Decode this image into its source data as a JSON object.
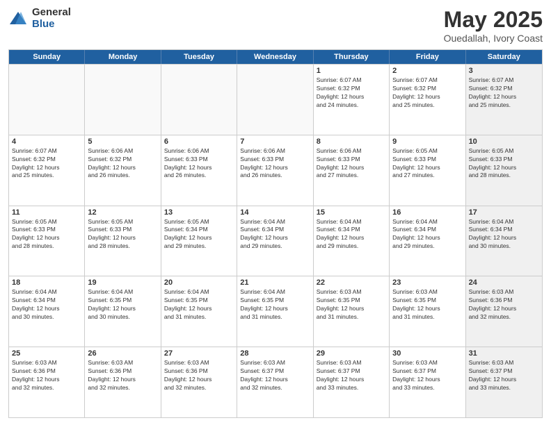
{
  "logo": {
    "general": "General",
    "blue": "Blue"
  },
  "title": {
    "month": "May 2025",
    "location": "Ouedallah, Ivory Coast"
  },
  "header_days": [
    "Sunday",
    "Monday",
    "Tuesday",
    "Wednesday",
    "Thursday",
    "Friday",
    "Saturday"
  ],
  "rows": [
    [
      {
        "day": "",
        "text": "",
        "empty": true
      },
      {
        "day": "",
        "text": "",
        "empty": true
      },
      {
        "day": "",
        "text": "",
        "empty": true
      },
      {
        "day": "",
        "text": "",
        "empty": true
      },
      {
        "day": "1",
        "text": "Sunrise: 6:07 AM\nSunset: 6:32 PM\nDaylight: 12 hours\nand 24 minutes.",
        "empty": false
      },
      {
        "day": "2",
        "text": "Sunrise: 6:07 AM\nSunset: 6:32 PM\nDaylight: 12 hours\nand 25 minutes.",
        "empty": false
      },
      {
        "day": "3",
        "text": "Sunrise: 6:07 AM\nSunset: 6:32 PM\nDaylight: 12 hours\nand 25 minutes.",
        "empty": false,
        "shaded": true
      }
    ],
    [
      {
        "day": "4",
        "text": "Sunrise: 6:07 AM\nSunset: 6:32 PM\nDaylight: 12 hours\nand 25 minutes.",
        "empty": false
      },
      {
        "day": "5",
        "text": "Sunrise: 6:06 AM\nSunset: 6:32 PM\nDaylight: 12 hours\nand 26 minutes.",
        "empty": false
      },
      {
        "day": "6",
        "text": "Sunrise: 6:06 AM\nSunset: 6:33 PM\nDaylight: 12 hours\nand 26 minutes.",
        "empty": false
      },
      {
        "day": "7",
        "text": "Sunrise: 6:06 AM\nSunset: 6:33 PM\nDaylight: 12 hours\nand 26 minutes.",
        "empty": false
      },
      {
        "day": "8",
        "text": "Sunrise: 6:06 AM\nSunset: 6:33 PM\nDaylight: 12 hours\nand 27 minutes.",
        "empty": false
      },
      {
        "day": "9",
        "text": "Sunrise: 6:05 AM\nSunset: 6:33 PM\nDaylight: 12 hours\nand 27 minutes.",
        "empty": false
      },
      {
        "day": "10",
        "text": "Sunrise: 6:05 AM\nSunset: 6:33 PM\nDaylight: 12 hours\nand 28 minutes.",
        "empty": false,
        "shaded": true
      }
    ],
    [
      {
        "day": "11",
        "text": "Sunrise: 6:05 AM\nSunset: 6:33 PM\nDaylight: 12 hours\nand 28 minutes.",
        "empty": false
      },
      {
        "day": "12",
        "text": "Sunrise: 6:05 AM\nSunset: 6:33 PM\nDaylight: 12 hours\nand 28 minutes.",
        "empty": false
      },
      {
        "day": "13",
        "text": "Sunrise: 6:05 AM\nSunset: 6:34 PM\nDaylight: 12 hours\nand 29 minutes.",
        "empty": false
      },
      {
        "day": "14",
        "text": "Sunrise: 6:04 AM\nSunset: 6:34 PM\nDaylight: 12 hours\nand 29 minutes.",
        "empty": false
      },
      {
        "day": "15",
        "text": "Sunrise: 6:04 AM\nSunset: 6:34 PM\nDaylight: 12 hours\nand 29 minutes.",
        "empty": false
      },
      {
        "day": "16",
        "text": "Sunrise: 6:04 AM\nSunset: 6:34 PM\nDaylight: 12 hours\nand 29 minutes.",
        "empty": false
      },
      {
        "day": "17",
        "text": "Sunrise: 6:04 AM\nSunset: 6:34 PM\nDaylight: 12 hours\nand 30 minutes.",
        "empty": false,
        "shaded": true
      }
    ],
    [
      {
        "day": "18",
        "text": "Sunrise: 6:04 AM\nSunset: 6:34 PM\nDaylight: 12 hours\nand 30 minutes.",
        "empty": false
      },
      {
        "day": "19",
        "text": "Sunrise: 6:04 AM\nSunset: 6:35 PM\nDaylight: 12 hours\nand 30 minutes.",
        "empty": false
      },
      {
        "day": "20",
        "text": "Sunrise: 6:04 AM\nSunset: 6:35 PM\nDaylight: 12 hours\nand 31 minutes.",
        "empty": false
      },
      {
        "day": "21",
        "text": "Sunrise: 6:04 AM\nSunset: 6:35 PM\nDaylight: 12 hours\nand 31 minutes.",
        "empty": false
      },
      {
        "day": "22",
        "text": "Sunrise: 6:03 AM\nSunset: 6:35 PM\nDaylight: 12 hours\nand 31 minutes.",
        "empty": false
      },
      {
        "day": "23",
        "text": "Sunrise: 6:03 AM\nSunset: 6:35 PM\nDaylight: 12 hours\nand 31 minutes.",
        "empty": false
      },
      {
        "day": "24",
        "text": "Sunrise: 6:03 AM\nSunset: 6:36 PM\nDaylight: 12 hours\nand 32 minutes.",
        "empty": false,
        "shaded": true
      }
    ],
    [
      {
        "day": "25",
        "text": "Sunrise: 6:03 AM\nSunset: 6:36 PM\nDaylight: 12 hours\nand 32 minutes.",
        "empty": false
      },
      {
        "day": "26",
        "text": "Sunrise: 6:03 AM\nSunset: 6:36 PM\nDaylight: 12 hours\nand 32 minutes.",
        "empty": false
      },
      {
        "day": "27",
        "text": "Sunrise: 6:03 AM\nSunset: 6:36 PM\nDaylight: 12 hours\nand 32 minutes.",
        "empty": false
      },
      {
        "day": "28",
        "text": "Sunrise: 6:03 AM\nSunset: 6:37 PM\nDaylight: 12 hours\nand 32 minutes.",
        "empty": false
      },
      {
        "day": "29",
        "text": "Sunrise: 6:03 AM\nSunset: 6:37 PM\nDaylight: 12 hours\nand 33 minutes.",
        "empty": false
      },
      {
        "day": "30",
        "text": "Sunrise: 6:03 AM\nSunset: 6:37 PM\nDaylight: 12 hours\nand 33 minutes.",
        "empty": false
      },
      {
        "day": "31",
        "text": "Sunrise: 6:03 AM\nSunset: 6:37 PM\nDaylight: 12 hours\nand 33 minutes.",
        "empty": false,
        "shaded": true
      }
    ]
  ]
}
